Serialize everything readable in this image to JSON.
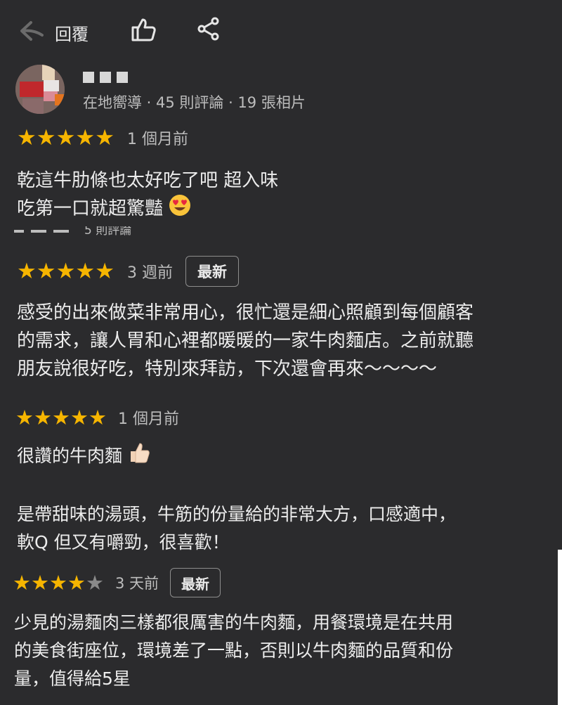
{
  "toolbar": {
    "back_icon": "back-arrow-icon",
    "reply_label": "回覆",
    "like_icon": "thumbs-up-icon",
    "share_icon": "share-icon"
  },
  "first_review": {
    "reviewer_meta": "在地嚮導 · 45 則評論 · 19 張相片",
    "rating": 5,
    "time": "1 個月前",
    "lines": [
      "乾這牛肋條也太好吃了吧 超入味",
      "吃第一口就超驚豔"
    ],
    "emoji": "heart-eyes-emoji"
  },
  "cut_row_text": "5 則評論",
  "reviews": [
    {
      "rating": 5,
      "time": "3 週前",
      "badge": "最新",
      "lines": [
        "感受的出來做菜非常用心，很忙還是細心照顧到每個顧客",
        "的需求，讓人胃和心裡都暖暖的一家牛肉麵店。之前就聽",
        "朋友說很好吃，特別來拜訪，下次還會再來～～～～"
      ]
    },
    {
      "rating": 5,
      "time": "1 個月前",
      "lines": [
        "很讚的牛肉麵",
        "",
        "是帶甜味的湯頭，牛筋的份量給的非常大方，口感適中，",
        "軟Q 但又有嚼勁，很喜歡！"
      ],
      "emoji": "thumbs-up-emoji"
    },
    {
      "rating": 4,
      "time": "3 天前",
      "badge": "最新",
      "lines": [
        "少見的湯麵肉三樣都很厲害的牛肉麵，用餐環境是在共用",
        "的美食街座位，環境差了一點，否則以牛肉麵的品質和份",
        "量，值得給5星"
      ]
    }
  ],
  "colors": {
    "background": "#2b2b2d",
    "star": "#f6b500",
    "star_empty": "#8a8a8a",
    "text": "#ececec",
    "muted": "#bdbdbd"
  }
}
